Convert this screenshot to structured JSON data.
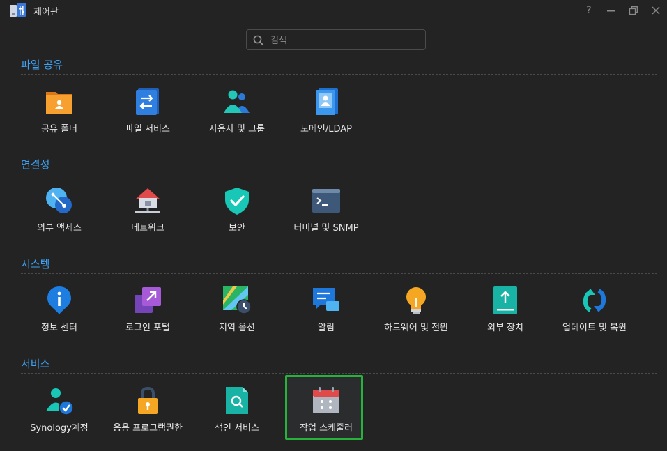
{
  "window": {
    "title": "제어판",
    "help": "?",
    "minimize": "−",
    "restore": "❐",
    "close": "✕"
  },
  "search": {
    "placeholder": "검색"
  },
  "sections": [
    {
      "title": "파일 공유",
      "items": [
        "공유 폴더",
        "파일 서비스",
        "사용자 및 그룹",
        "도메인/LDAP"
      ]
    },
    {
      "title": "연결성",
      "items": [
        "외부 액세스",
        "네트워크",
        "보안",
        "터미널 및 SNMP"
      ]
    },
    {
      "title": "시스템",
      "items": [
        "정보 센터",
        "로그인 포털",
        "지역 옵션",
        "알림",
        "하드웨어 및 전원",
        "외부 장치",
        "업데이트 및 복원"
      ]
    },
    {
      "title": "서비스",
      "items": [
        "Synology계정",
        "응용 프로그램권한",
        "색인 서비스",
        "작업 스케줄러"
      ]
    }
  ],
  "selected_item": "작업 스케줄러",
  "colors": {
    "accent": "#3ea3f5",
    "selection": "#27b33b"
  }
}
